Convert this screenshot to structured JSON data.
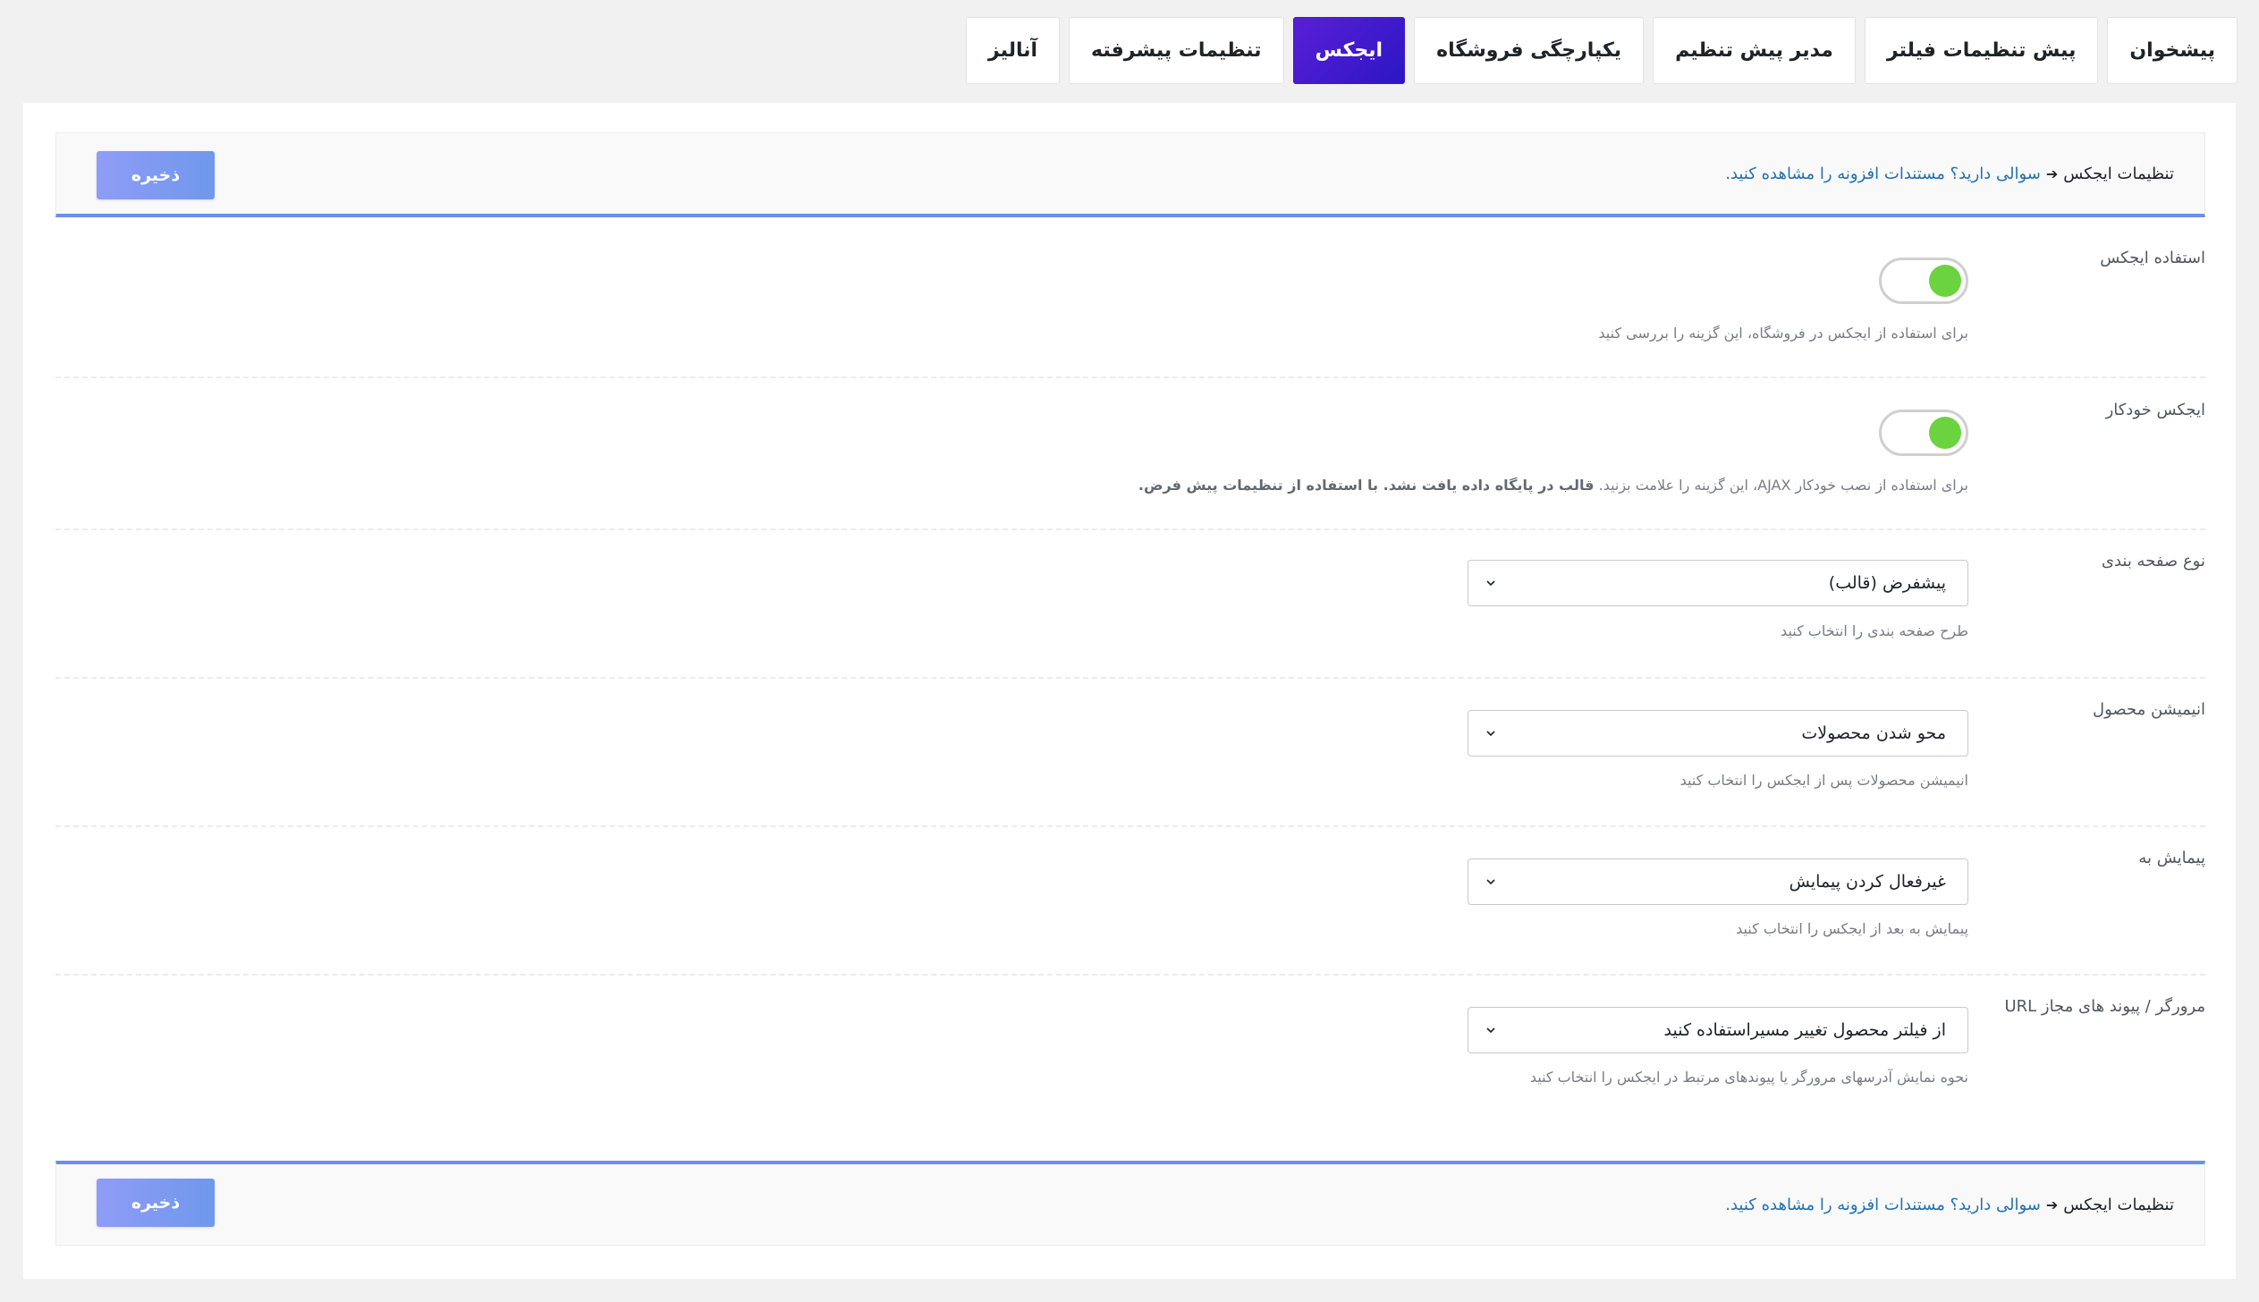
{
  "tabs": [
    {
      "label": "پیشخوان",
      "active": false
    },
    {
      "label": "پیش تنظیمات فیلتر",
      "active": false
    },
    {
      "label": "مدیر پیش تنظیم",
      "active": false
    },
    {
      "label": "یکپارچگی فروشگاه",
      "active": false
    },
    {
      "label": "ایجکس",
      "active": true
    },
    {
      "label": "تنظیمات پیشرفته",
      "active": false
    },
    {
      "label": "آنالیز",
      "active": false
    }
  ],
  "header_bar": {
    "title": "تنظیمات ایجکس",
    "arrow": "➔",
    "help_link": "سوالی دارید؟ مستندات افزونه را مشاهده کنید.",
    "save_label": "ذخیره"
  },
  "footer_bar": {
    "title": "تنظیمات ایجکس",
    "arrow": "➔",
    "help_link": "سوالی دارید؟ مستندات افزونه را مشاهده کنید.",
    "save_label": "ذخیره"
  },
  "settings": {
    "use_ajax": {
      "label": "استفاده ایجکس",
      "enabled": true,
      "description": "برای استفاده از ایجکس در فروشگاه، این گزینه را بررسی کنید"
    },
    "auto_ajax": {
      "label": "ایجکس خودکار",
      "enabled": true,
      "description": "برای استفاده از نصب خودکار AJAX، این گزینه را علامت بزنید.",
      "description_bold": "قالب در پایگاه داده یافت نشد. با استفاده از تنظیمات پیش فرض."
    },
    "pagination_type": {
      "label": "نوع صفحه بندی",
      "value": "پیشفرض (قالب)",
      "description": "طرح صفحه بندی را انتخاب کنید"
    },
    "product_animation": {
      "label": "انیمیشن محصول",
      "value": "محو شدن محصولات",
      "description": "انیمیشن محصولات پس از ایجکس را انتخاب کنید"
    },
    "scroll_to": {
      "label": "پیمایش به",
      "value": "غیرفعال کردن پیمایش",
      "description": "پیمایش به بعد از ایجکس را انتخاب کنید"
    },
    "browser_url": {
      "label": "URL مرورگر / پیوند های مجاز",
      "value": "از فیلتر محصول تغییر مسیراستفاده کنید",
      "description": "نحوه نمایش آدرسهای مرورگر یا پیوندهای مرتبط در ایجکس را انتخاب کنید"
    }
  },
  "colors": {
    "active_tab": "#3b1bcc",
    "toggle_on": "#6bd33f",
    "accent_line": "#6a8ff0",
    "save_button": "#7f9af2",
    "link": "#2271b1"
  }
}
